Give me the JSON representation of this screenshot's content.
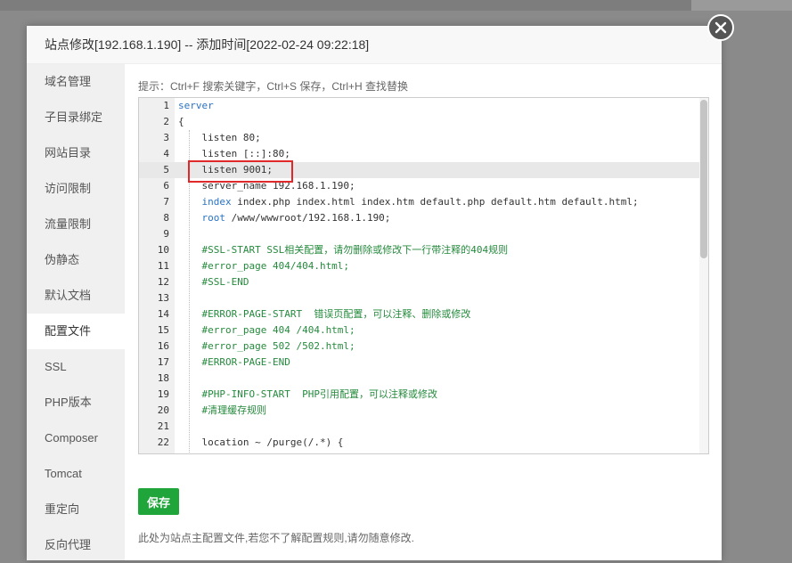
{
  "modal": {
    "title": "站点修改[192.168.1.190] -- 添加时间[2022-02-24 09:22:18]",
    "close_icon": "close-icon"
  },
  "sidebar": {
    "items": [
      {
        "label": "域名管理"
      },
      {
        "label": "子目录绑定"
      },
      {
        "label": "网站目录"
      },
      {
        "label": "访问限制"
      },
      {
        "label": "流量限制"
      },
      {
        "label": "伪静态"
      },
      {
        "label": "默认文档"
      },
      {
        "label": "配置文件",
        "active": true
      },
      {
        "label": "SSL"
      },
      {
        "label": "PHP版本"
      },
      {
        "label": "Composer"
      },
      {
        "label": "Tomcat"
      },
      {
        "label": "重定向"
      },
      {
        "label": "反向代理"
      }
    ]
  },
  "editor": {
    "tip": "提示：Ctrl+F 搜索关键字，Ctrl+S 保存，Ctrl+H 查找替换",
    "active_line": 5,
    "lines": [
      {
        "n": "1",
        "text": "server",
        "kind": "kw"
      },
      {
        "n": "2",
        "text": "{",
        "kind": "plain"
      },
      {
        "n": "3",
        "text": "    listen 80;",
        "kind": "plain"
      },
      {
        "n": "4",
        "text": "    listen [::]:80;",
        "kind": "plain"
      },
      {
        "n": "5",
        "text": "    listen 9001;",
        "kind": "plain"
      },
      {
        "n": "6",
        "text": "    server_name 192.168.1.190;",
        "kind": "plain"
      },
      {
        "n": "7",
        "kw": "index",
        "rest": " index.php index.html index.htm default.php default.htm default.html;",
        "kind": "mixed"
      },
      {
        "n": "8",
        "kw": "root",
        "rest": " /www/wwwroot/192.168.1.190;",
        "kind": "mixed"
      },
      {
        "n": "9",
        "text": "",
        "kind": "plain"
      },
      {
        "n": "10",
        "text": "    #SSL-START SSL相关配置，请勿删除或修改下一行带注释的404规则",
        "kind": "cm"
      },
      {
        "n": "11",
        "text": "    #error_page 404/404.html;",
        "kind": "cm"
      },
      {
        "n": "12",
        "text": "    #SSL-END",
        "kind": "cm"
      },
      {
        "n": "13",
        "text": "",
        "kind": "plain"
      },
      {
        "n": "14",
        "text": "    #ERROR-PAGE-START  错误页配置，可以注释、删除或修改",
        "kind": "cm"
      },
      {
        "n": "15",
        "text": "    #error_page 404 /404.html;",
        "kind": "cm"
      },
      {
        "n": "16",
        "text": "    #error_page 502 /502.html;",
        "kind": "cm"
      },
      {
        "n": "17",
        "text": "    #ERROR-PAGE-END",
        "kind": "cm"
      },
      {
        "n": "18",
        "text": "",
        "kind": "plain"
      },
      {
        "n": "19",
        "text": "    #PHP-INFO-START  PHP引用配置，可以注释或修改",
        "kind": "cm"
      },
      {
        "n": "20",
        "text": "    #清理缓存规则",
        "kind": "cm"
      },
      {
        "n": "21",
        "text": "",
        "kind": "plain"
      },
      {
        "n": "22",
        "text": "    location ~ /purge(/.*) {",
        "kind": "plain"
      }
    ]
  },
  "actions": {
    "save_label": "保存"
  },
  "footer_note": "此处为站点主配置文件,若您不了解配置规则,请勿随意修改.",
  "colors": {
    "accent": "#20a53a",
    "highlight_box": "#e0292b",
    "keyword": "#2a73c5",
    "comment": "#258a3d"
  }
}
